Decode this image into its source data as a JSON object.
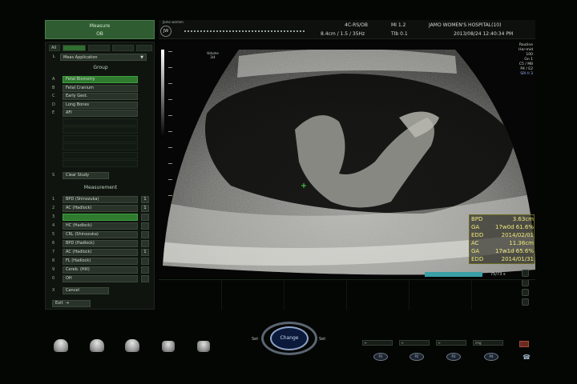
{
  "left_panel": {
    "measure_label_line1": "Measure",
    "measure_label_line2": "OB",
    "all_label": "All",
    "app_label": "L",
    "app_select": "Meas Application",
    "group_title": "Group",
    "group_items": [
      {
        "idx": "A",
        "label": "Fetal Biometry",
        "selected": true
      },
      {
        "idx": "B",
        "label": "Fetal Cranium",
        "selected": false
      },
      {
        "idx": "C",
        "label": "Early Gest.",
        "selected": false
      },
      {
        "idx": "D",
        "label": "Long Bones",
        "selected": false
      },
      {
        "idx": "E",
        "label": "AFI",
        "selected": false
      }
    ],
    "clear_idx": "S",
    "clear_label": "Clear Study",
    "measurement_title": "Measurement",
    "measurement_items": [
      {
        "idx": "1",
        "label": "BPD (Shinozuka)",
        "mark": "1",
        "selected": false
      },
      {
        "idx": "2",
        "label": "AC (Hadlock)",
        "mark": "1",
        "selected": false
      },
      {
        "idx": "3",
        "label": "",
        "mark": "",
        "selected": true
      },
      {
        "idx": "4",
        "label": "HC (Hadlock)",
        "mark": "",
        "selected": false
      },
      {
        "idx": "5",
        "label": "CRL (Shinozuka)",
        "mark": "",
        "selected": false
      },
      {
        "idx": "6",
        "label": "BPD (Hadlock)",
        "mark": "",
        "selected": false
      },
      {
        "idx": "7",
        "label": "AC (Hadlock)",
        "mark": "1",
        "selected": false
      },
      {
        "idx": "8",
        "label": "FL (Hadlock)",
        "mark": "",
        "selected": false
      },
      {
        "idx": "9",
        "label": "Cereb. (Hill)",
        "mark": "",
        "selected": false
      },
      {
        "idx": "0",
        "label": "OH",
        "mark": "",
        "selected": false
      }
    ],
    "cancel_idx": "X",
    "cancel_label": "Cancel",
    "exit_label": "Exit"
  },
  "header": {
    "logo": "JW",
    "hospital_short": "Jamo women",
    "probe": "4C-RS/OB",
    "depth": "8.4cm / 1.5 / 35Hz",
    "mi": "MI  1.2",
    "tib": "TIb  0.1",
    "hospital": "JAMO WOMEN'S HOSPITAL(10)",
    "datetime": "2013/08/24   12:40:34 PM"
  },
  "image": {
    "volume_label_1": "Volume",
    "volume_label_2": "3/4",
    "side_info": [
      "Routine",
      "Har-mid",
      "100",
      "Gn  1",
      "C5 / M8",
      "P4 / E2"
    ],
    "sri": "SRI II 3"
  },
  "measurements": [
    {
      "k": "BPD",
      "v": "3.63cm"
    },
    {
      "k": "GA",
      "v": "17w0d 61.6%"
    },
    {
      "k": "EDD",
      "v": "2014/02/01"
    },
    {
      "k": "AC",
      "v": "11.36cm"
    },
    {
      "k": "GA",
      "v": "17w1d 65.6%"
    },
    {
      "k": "EDD",
      "v": "2014/01/31"
    }
  ],
  "cine": {
    "text": "75/73 s"
  },
  "controls": {
    "dial_center": "Change",
    "dial_left": "Set",
    "dial_right": "Set",
    "rbtns": [
      "P1",
      "P2",
      "P3",
      "P4"
    ],
    "sbtns": [
      "",
      "",
      "",
      "img"
    ]
  },
  "colors": {
    "accent_green": "#2f7a2f",
    "measurement_yellow": "#f1e97a",
    "cine_cyan": "#3aa0a6"
  }
}
